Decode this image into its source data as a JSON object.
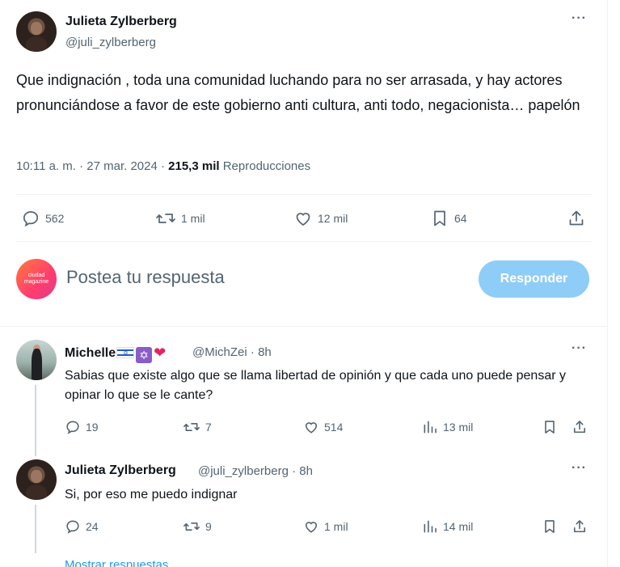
{
  "tweet": {
    "author_name": "Julieta Zylberberg",
    "author_handle": "@juli_zylberberg",
    "text": "Que indignación , toda una comunidad luchando para no ser arrasada, y hay actores pronunciándose a favor de este gobierno anti cultura, anti todo, negacionista… papelón",
    "timestamp": "10:11 a. m. · 27 mar. 2024 · ",
    "views_count": "215,3 mil",
    "views_label": " Reproducciones",
    "more_icon": "···",
    "actions": {
      "replies": "562",
      "reposts": "1 mil",
      "likes": "12 mil",
      "bookmarks": "64"
    }
  },
  "compose": {
    "avatar_text": "ciudad magazine",
    "placeholder": "Postea tu respuesta",
    "reply_button": "Responder"
  },
  "replies": [
    {
      "author_name": "Michelle",
      "author_handle": "@MichZei",
      "dot": " · ",
      "time": "8h",
      "text": "Sabias que existe algo que se llama libertad de opinión y que cada uno puede pensar y opinar lo que se le cante?",
      "badge_star": "✡",
      "badge_heart": "❤",
      "actions": {
        "replies": "19",
        "reposts": "7",
        "likes": "514",
        "views": "13 mil"
      }
    },
    {
      "author_name": "Julieta Zylberberg",
      "author_handle": "@juli_zylberberg",
      "dot": " · ",
      "time": "8h",
      "text": "Si, por eso me puedo indignar",
      "actions": {
        "replies": "24",
        "reposts": "9",
        "likes": "1 mil",
        "views": "14 mil"
      }
    }
  ],
  "show_replies": "Mostrar respuestas",
  "colors": {
    "accent": "#1d9bf0",
    "reply_button_disabled": "#8ecdf7",
    "secondary_text": "#536471"
  }
}
